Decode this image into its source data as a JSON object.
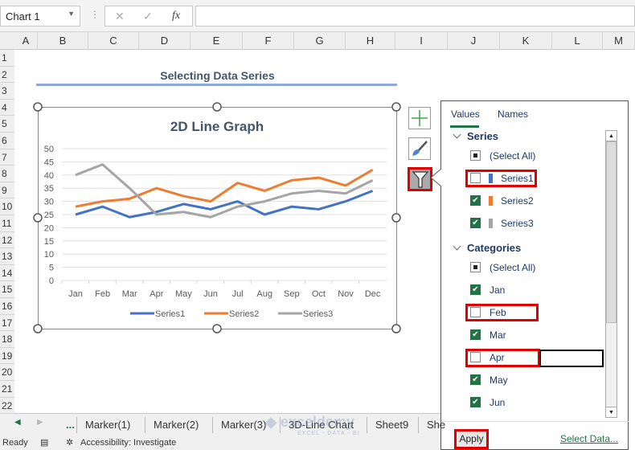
{
  "namebox": {
    "value": "Chart 1"
  },
  "formula_bar": {
    "cancel": "✕",
    "enter": "✓",
    "fx": "fx",
    "value": ""
  },
  "columns": [
    "A",
    "B",
    "C",
    "D",
    "E",
    "F",
    "G",
    "H",
    "I",
    "J",
    "K",
    "L",
    "M"
  ],
  "rows": [
    "1",
    "2",
    "3",
    "4",
    "5",
    "6",
    "7",
    "8",
    "9",
    "10",
    "11",
    "12",
    "13",
    "14",
    "15",
    "16",
    "17",
    "18",
    "19",
    "20",
    "21",
    "22"
  ],
  "sheet_heading": "Selecting Data Series",
  "colors": {
    "series1": "#4472c4",
    "series2": "#ed7d31",
    "series3": "#a5a5a5",
    "accent": "#217346",
    "highlight": "#e00000"
  },
  "chart_data": {
    "type": "line",
    "title": "2D Line Graph",
    "categories": [
      "Jan",
      "Feb",
      "Mar",
      "Apr",
      "May",
      "Jun",
      "Jul",
      "Aug",
      "Sep",
      "Oct",
      "Nov",
      "Dec"
    ],
    "series": [
      {
        "name": "Series1",
        "values": [
          25,
          28,
          24,
          26,
          29,
          27,
          30,
          25,
          28,
          27,
          30,
          34
        ]
      },
      {
        "name": "Series2",
        "values": [
          28,
          30,
          31,
          35,
          32,
          30,
          37,
          34,
          38,
          39,
          36,
          42
        ]
      },
      {
        "name": "Series3",
        "values": [
          40,
          44,
          35,
          25,
          26,
          24,
          28,
          30,
          33,
          34,
          33,
          38
        ]
      }
    ],
    "yticks": [
      "0",
      "5",
      "10",
      "15",
      "20",
      "25",
      "30",
      "35",
      "40",
      "45",
      "50"
    ],
    "ylim": [
      0,
      50
    ],
    "grid": true,
    "legend": "bottom"
  },
  "chart_buttons": [
    "plus-icon",
    "brush-icon",
    "filter-icon"
  ],
  "filter_pane": {
    "tabs": [
      "Values",
      "Names"
    ],
    "series_header": "Series",
    "series_items": [
      {
        "label": "(Select All)",
        "state": "partial"
      },
      {
        "label": "Series1",
        "state": "unchecked"
      },
      {
        "label": "Series2",
        "state": "checked"
      },
      {
        "label": "Series3",
        "state": "checked"
      }
    ],
    "categories_header": "Categories",
    "category_items": [
      {
        "label": "(Select All)",
        "state": "partial"
      },
      {
        "label": "Jan",
        "state": "checked"
      },
      {
        "label": "Feb",
        "state": "unchecked"
      },
      {
        "label": "Mar",
        "state": "checked"
      },
      {
        "label": "Apr",
        "state": "unchecked"
      },
      {
        "label": "May",
        "state": "checked"
      },
      {
        "label": "Jun",
        "state": "checked"
      }
    ],
    "apply": "Apply",
    "select_data": "Select Data..."
  },
  "sheet_tabs": [
    "...",
    "Marker(1)",
    "Marker(2)",
    "Marker(3)",
    "3D-Line Chart",
    "Sheet9",
    "She"
  ],
  "status": {
    "ready": "Ready",
    "accessibility": "Accessibility: Investigate"
  },
  "watermark": {
    "brand": "exceldemy",
    "tagline": "EXCEL · DATA · BI"
  }
}
